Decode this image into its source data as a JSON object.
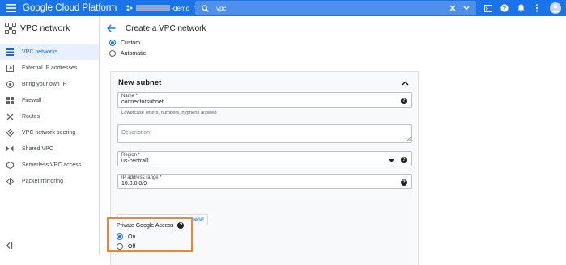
{
  "topbar": {
    "brand": "Google Cloud Platform",
    "project_suffix": "-demo",
    "search_value": "vpc",
    "color": "#1a73e8"
  },
  "sidebar": {
    "title": "VPC network",
    "items": [
      {
        "label": "VPC networks",
        "icon": "vpc-networks-icon",
        "active": true
      },
      {
        "label": "External IP addresses",
        "icon": "external-ip-icon",
        "active": false
      },
      {
        "label": "Bring your own IP",
        "icon": "byoip-icon",
        "active": false
      },
      {
        "label": "Firewall",
        "icon": "firewall-icon",
        "active": false
      },
      {
        "label": "Routes",
        "icon": "routes-icon",
        "active": false
      },
      {
        "label": "VPC network peering",
        "icon": "peering-icon",
        "active": false
      },
      {
        "label": "Shared VPC",
        "icon": "shared-vpc-icon",
        "active": false
      },
      {
        "label": "Serverless VPC access",
        "icon": "serverless-icon",
        "active": false
      },
      {
        "label": "Packet mirroring",
        "icon": "packet-mirroring-icon",
        "active": false
      }
    ]
  },
  "main": {
    "title": "Create a VPC network",
    "subnet_mode": {
      "options": [
        "Custom",
        "Automatic"
      ],
      "selected": "Custom"
    },
    "subnet_card": {
      "title": "New subnet",
      "name": {
        "label": "Name *",
        "value": "connectorsubnet",
        "hint": "Lowercase letters, numbers, hyphens allowed"
      },
      "description": {
        "placeholder": "Description"
      },
      "region": {
        "label": "Region *",
        "value": "us-central1"
      },
      "ip_range": {
        "label": "IP address range *",
        "value": "10.0.0.0/9"
      },
      "secondary_button": "CREATE SECONDARY IP RANGE",
      "private_google_access": {
        "label": "Private Google Access",
        "options": [
          "On",
          "Off"
        ],
        "selected": "On",
        "highlight_color": "#e8873a"
      }
    }
  }
}
